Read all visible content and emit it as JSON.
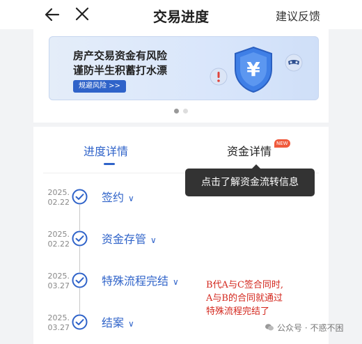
{
  "header": {
    "title": "交易进度",
    "feedback": "建议反馈"
  },
  "banner": {
    "line1": "房产交易资金有风险",
    "line2": "谨防半生积蓄打水漂",
    "button": "规避风险 >>",
    "shield_symbol": "¥",
    "slides": 2,
    "active_slide": 1
  },
  "tabs": {
    "progress": "进度详情",
    "funds": "资金详情",
    "funds_badge": "NEW"
  },
  "tooltip": "点击了解资金流转信息",
  "steps": [
    {
      "year": "2025.",
      "day": "02.22",
      "name": "签约"
    },
    {
      "year": "2025.",
      "day": "02.22",
      "name": "资金存管"
    },
    {
      "year": "2025.",
      "day": "03.27",
      "name": "特殊流程完结"
    },
    {
      "year": "2025.",
      "day": "03.27",
      "name": "结案"
    }
  ],
  "note": {
    "line1": "B代A与C签合同时,",
    "line2": "A与B的合同就通过",
    "line3": "特殊流程完结了"
  },
  "watermark": "公众号 · 不惑不困",
  "colors": {
    "accent": "#2f63c9",
    "badge": "#f05a3c",
    "note": "#d3261c",
    "tooltip_bg": "#333333"
  },
  "icons": {
    "back": "arrow-left",
    "close": "x",
    "step": "check-circle",
    "expand": "chevron-down"
  }
}
